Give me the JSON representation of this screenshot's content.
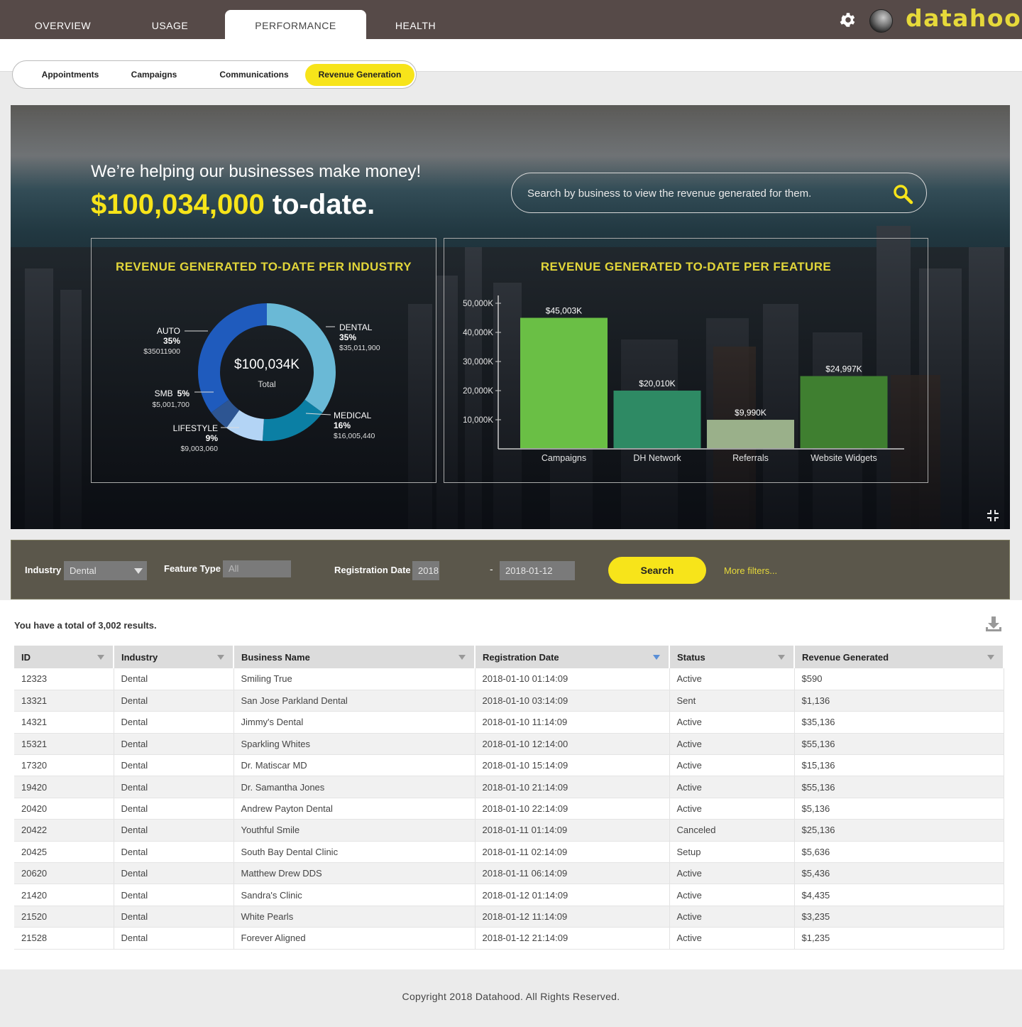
{
  "nav": {
    "tabs": [
      {
        "label": "OVERVIEW",
        "active": false
      },
      {
        "label": "USAGE",
        "active": false
      },
      {
        "label": "PERFORMANCE",
        "active": true
      },
      {
        "label": "HEALTH",
        "active": false
      }
    ],
    "logo": "datahood"
  },
  "subtabs": [
    {
      "label": "Appointments",
      "active": false
    },
    {
      "label": "Campaigns",
      "active": false
    },
    {
      "label": "Communications",
      "active": false
    },
    {
      "label": "Revenue Generation",
      "active": true
    }
  ],
  "hero": {
    "subtitle": "We’re helping our businesses make money!",
    "amount": "$100,034,000",
    "amount_suffix": "to-date.",
    "search_placeholder": "Search by business to view the revenue generated for them."
  },
  "chart_data": [
    {
      "type": "pie",
      "title": "REVENUE GENERATED TO-DATE PER INDUSTRY",
      "center_value": "$100,034K",
      "center_label": "Total",
      "slices": [
        {
          "label": "DENTAL",
          "percent_label": "35%",
          "amount": "$35,011,900",
          "value": 35,
          "color": "#6ab9d6"
        },
        {
          "label": "MEDICAL",
          "percent_label": "16%",
          "amount": "$16,005,440",
          "value": 16,
          "color": "#0b7fa4"
        },
        {
          "label": "LIFESTYLE",
          "percent_label": "9%",
          "amount": "$9,003,060",
          "value": 9,
          "color": "#b3d4f5"
        },
        {
          "label": "SMB",
          "percent_label": "5%",
          "amount": "$5,001,700",
          "value": 5,
          "color": "#2d5592"
        },
        {
          "label": "AUTO",
          "percent_label": "35%",
          "amount": "$35011900",
          "value": 35,
          "color": "#1f5bbd"
        }
      ]
    },
    {
      "type": "bar",
      "title": "REVENUE GENERATED TO-DATE PER FEATURE",
      "categories": [
        "Campaigns",
        "DH Network",
        "Referrals",
        "Website Widgets"
      ],
      "values": [
        45003,
        20010,
        9990,
        24997
      ],
      "value_labels": [
        "$45,003K",
        "$20,010K",
        "$9,990K",
        "$24,997K"
      ],
      "colors": [
        "#6abf45",
        "#2e8a64",
        "#9ab08a",
        "#3f7f30"
      ],
      "yticks": [
        10000,
        20000,
        30000,
        40000,
        50000
      ],
      "ytick_labels": [
        "10,000K",
        "20,000K",
        "30,000K",
        "40,000K",
        "50,000K"
      ],
      "ylim": [
        0,
        50000
      ]
    }
  ],
  "filters": {
    "industry_label": "Industry",
    "industry_value": "Dental",
    "feature_label": "Feature Type",
    "feature_value": "All",
    "date_label": "Registration Date",
    "date_from": "2018",
    "date_sep": "-",
    "date_to": "2018-01-12",
    "search_label": "Search",
    "more_filters": "More filters..."
  },
  "results": {
    "summary": "You have a total of 3,002 results.",
    "columns": [
      "ID",
      "Industry",
      "Business Name",
      "Registration Date",
      "Status",
      "Revenue Generated"
    ],
    "rows": [
      [
        "12323",
        "Dental",
        "Smiling True",
        "2018-01-10 01:14:09",
        "Active",
        "$590"
      ],
      [
        "13321",
        "Dental",
        "San Jose Parkland Dental",
        "2018-01-10 03:14:09",
        "Sent",
        "$1,136"
      ],
      [
        "14321",
        "Dental",
        "Jimmy's Dental",
        "2018-01-10 11:14:09",
        "Active",
        "$35,136"
      ],
      [
        "15321",
        "Dental",
        "Sparkling Whites",
        "2018-01-10 12:14:00",
        "Active",
        "$55,136"
      ],
      [
        "17320",
        "Dental",
        "Dr. Matiscar MD",
        "2018-01-10 15:14:09",
        "Active",
        "$15,136"
      ],
      [
        "19420",
        "Dental",
        "Dr. Samantha Jones",
        "2018-01-10 21:14:09",
        "Active",
        "$55,136"
      ],
      [
        "20420",
        "Dental",
        "Andrew Payton Dental",
        "2018-01-10 22:14:09",
        "Active",
        "$5,136"
      ],
      [
        "20422",
        "Dental",
        "Youthful Smile",
        "2018-01-11 01:14:09",
        "Canceled",
        "$25,136"
      ],
      [
        "20425",
        "Dental",
        "South Bay Dental Clinic",
        "2018-01-11 02:14:09",
        "Setup",
        "$5,636"
      ],
      [
        "20620",
        "Dental",
        "Matthew Drew DDS",
        "2018-01-11 06:14:09",
        "Active",
        "$5,436"
      ],
      [
        "21420",
        "Dental",
        "Sandra's Clinic",
        "2018-01-12 01:14:09",
        "Active",
        "$4,435"
      ],
      [
        "21520",
        "Dental",
        "White Pearls",
        "2018-01-12 11:14:09",
        "Active",
        "$3,235"
      ],
      [
        "21528",
        "Dental",
        "Forever Aligned",
        "2018-01-12 21:14:09",
        "Active",
        "$1,235"
      ]
    ]
  },
  "footer": "Copyright 2018 Datahood. All Rights Reserved.",
  "colors": {
    "accent": "#f7e41a",
    "topbar": "#564a48",
    "filterbar": "#5b574b"
  }
}
